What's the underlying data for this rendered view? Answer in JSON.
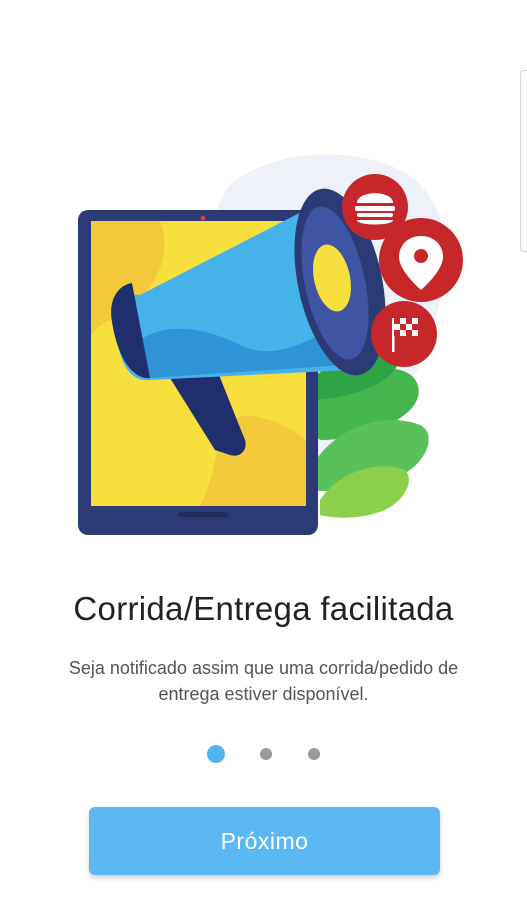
{
  "onboarding": {
    "title": "Corrida/Entrega facilitada",
    "description": "Seja notificado assim que uma corrida/pedido de entrega estiver disponível.",
    "page_indicator": {
      "total": 3,
      "active": 1
    },
    "next_label": "Próximo"
  },
  "illustration": {
    "icons": [
      "megaphone-icon",
      "tablet-icon",
      "burger-icon",
      "map-pin-icon",
      "checkered-flag-icon",
      "leaf-icon"
    ]
  },
  "colors": {
    "accent": "#5bb8f3",
    "dot_inactive": "#9a9a9a",
    "badge_red": "#c7272a",
    "tablet_screen": "#f7df3d",
    "megaphone_blue": "#45b3ea",
    "leaves_green": "#3bb54a"
  }
}
